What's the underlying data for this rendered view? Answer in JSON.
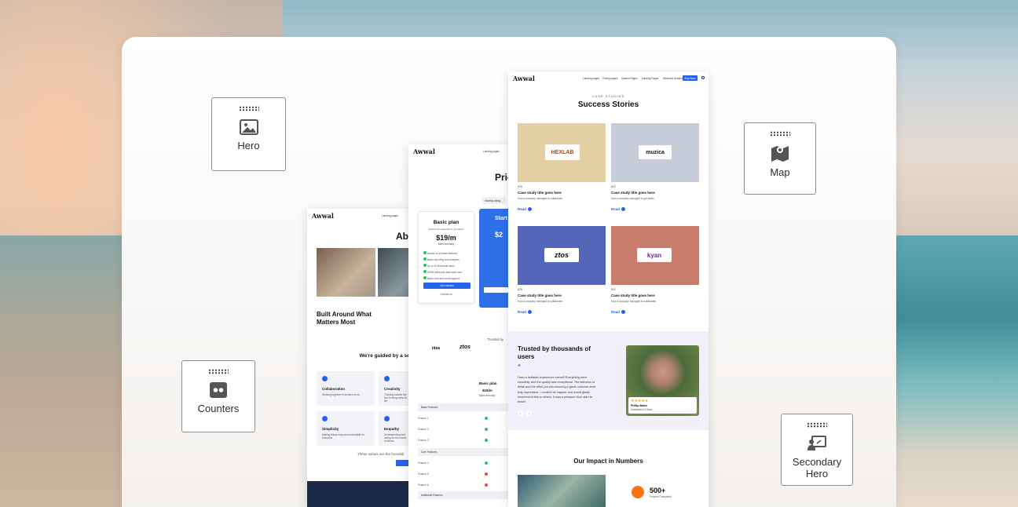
{
  "labels": {
    "hero": "Hero",
    "map": "Map",
    "counters": "Counters",
    "secondary_hero": "Secondary Hero"
  },
  "about_page": {
    "logo": "Awwal",
    "nav_item": "Landing pages",
    "title": "Abo",
    "heading": "Built Around What Matters Most",
    "values_intro": "We're guided by a se everythi",
    "values": [
      {
        "title": "Collaboration",
        "text": "Working together to achieve more."
      },
      {
        "title": "Creativity",
        "text": "Thinking outside the box to bring ideas to life."
      },
      {
        "title": "Simplicity",
        "text": "Making things easy and accessible for everyone."
      },
      {
        "title": "Empathy",
        "text": "Understanding and caring for the needs of others."
      }
    ],
    "footer_text": "These values are the foundati"
  },
  "pricing_page": {
    "logo": "Awwal",
    "nav_item": "Landing pages",
    "title": "Pric",
    "billing_toggle": "Monthly billing",
    "basic": {
      "name": "Basic plan",
      "desc": "Explore the essentials to get started",
      "price": "$19/m",
      "billed": "Billed annually",
      "features": [
        "Access to all basic features",
        "Basic reporting and analytics",
        "Up to 10 individual users",
        "20GB individual data each user",
        "Basic chat and email support"
      ],
      "cta": "Get started",
      "secondary": "Contact us"
    },
    "starter": {
      "name": "Start",
      "price": "$2"
    },
    "trusted_by": "Trusted by",
    "logos": [
      "idea",
      "ztos"
    ],
    "compare": {
      "plan": "Basic plan",
      "price": "$19/m",
      "billed": "Billed annually",
      "groups": [
        {
          "name": "Basic Features",
          "rows": [
            "Feature 1",
            "Feature 2",
            "Feature 3"
          ]
        },
        {
          "name": "Core Features",
          "rows": [
            "Feature 4",
            "Feature 5",
            "Feature 6"
          ]
        },
        {
          "name": "Additional Features",
          "rows": []
        }
      ]
    }
  },
  "case_page": {
    "logo": "Awwal",
    "nav": [
      "Landing pages",
      "Pricing pages",
      "System Pages",
      "Landing Pages",
      "Welcome Section"
    ],
    "nav_cta": "Buy Now",
    "eyebrow": "CASE STUDIES",
    "title": "Success Stories",
    "cases": [
      {
        "brand": "HEXLAB",
        "tag": "B2B",
        "title": "Case study title goes here",
        "desc": "How a company managed to collaborate",
        "link": "Read",
        "color": "#e3cfa3"
      },
      {
        "brand": "muzica",
        "tag": "B2C",
        "title": "Case study title goes here",
        "desc": "How a company managed to get faster",
        "link": "Read",
        "color": "#c6ccd8"
      },
      {
        "brand": "ztos",
        "tag": "B2B",
        "title": "Case study title goes here",
        "desc": "How a company managed to collaborate",
        "link": "Read",
        "color": "#5566b8"
      },
      {
        "brand": "kyan",
        "tag": "B2C",
        "title": "Case study title goes here",
        "desc": "How a company managed to collaborate",
        "link": "Read",
        "color": "#c97b6c"
      }
    ],
    "testimonial": {
      "title": "Trusted by thousands of users",
      "quote": "I had a fantastic experience overall! Everything went smoothly, and the quality was exceptional. The attention to detail and the effort put into ensuring a great outcome were truly impressive. I couldn't be happier and would gladly recommend this to others. It was a pleasure from start to finish!",
      "stars": "★★★★★",
      "name": "Phillip Bates",
      "role": "Satisfaction 5 Stars"
    },
    "impact": {
      "title": "Our Impact in Numbers",
      "value": "500+",
      "label": "Projects Completed"
    }
  }
}
